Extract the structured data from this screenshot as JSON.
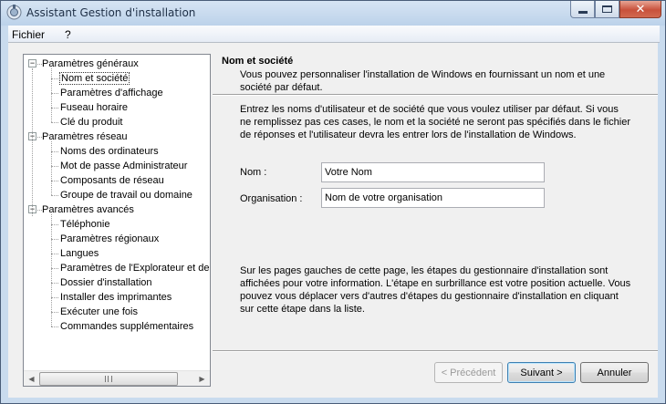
{
  "window": {
    "title": "Assistant Gestion d'installation",
    "caption": {
      "minimize": "minimize-icon",
      "maximize": "maximize-icon",
      "close": "✕"
    }
  },
  "menu": {
    "file": "Fichier",
    "help": "?"
  },
  "tree": {
    "groups": [
      {
        "label": "Paramètres généraux",
        "expander": "−",
        "items": [
          "Nom et société",
          "Paramètres d'affichage",
          "Fuseau horaire",
          "Clé du produit"
        ]
      },
      {
        "label": "Paramètres réseau",
        "expander": "−",
        "items": [
          "Noms des ordinateurs",
          "Mot de passe Administrateur",
          "Composants de réseau",
          "Groupe de travail ou domaine"
        ]
      },
      {
        "label": "Paramètres avancés",
        "expander": "−",
        "items": [
          "Téléphonie",
          "Paramètres régionaux",
          "Langues",
          "Paramètres de l'Explorateur et de",
          "Dossier d'installation",
          "Installer des imprimantes",
          "Exécuter une fois",
          "Commandes supplémentaires"
        ]
      }
    ],
    "selected": "Nom et société",
    "scroll_left": "◀",
    "scroll_right": "▶"
  },
  "header": {
    "title": "Nom et société",
    "description": "Vous pouvez personnaliser l'installation de Windows en fournissant un nom et une société par défaut."
  },
  "intro": "Entrez les noms d'utilisateur et de société que vous voulez utiliser par défaut. Si vous ne remplissez pas ces cases, le nom et la société ne seront pas spécifiés dans le fichier de réponses et l'utilisateur devra les entrer lors de l'installation de Windows.",
  "form": {
    "name_label": "Nom :",
    "name_value": "Votre Nom",
    "org_label": "Organisation :",
    "org_value": "Nom de votre organisation"
  },
  "help": "Sur les pages gauches de cette page, les étapes du gestionnaire d'installation sont affichées pour votre information. L'étape en surbrillance est votre position actuelle. Vous pouvez vous déplacer vers d'autres d'étapes du gestionnaire d'installation en cliquant sur cette étape dans la liste.",
  "buttons": {
    "back": "< Précédent",
    "next": "Suivant >",
    "cancel": "Annuler"
  }
}
